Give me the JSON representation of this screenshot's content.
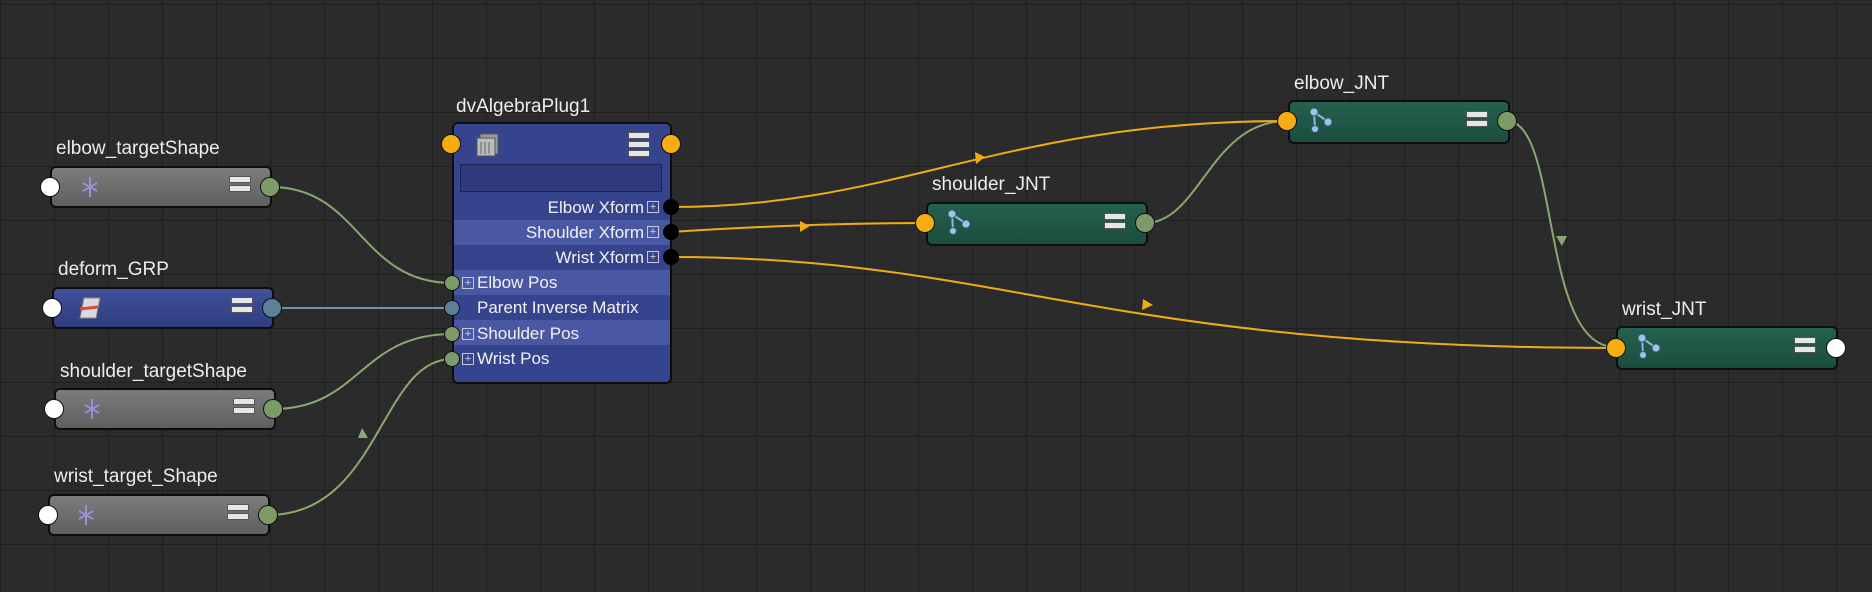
{
  "nodes": {
    "elbow_target": {
      "name": "elbow_targetShape",
      "icon": "locator-icon"
    },
    "deform_grp": {
      "name": "deform_GRP",
      "icon": "transform-icon"
    },
    "shoulder_target": {
      "name": "shoulder_targetShape",
      "icon": "locator-icon"
    },
    "wrist_target": {
      "name": "wrist_target_Shape",
      "icon": "locator-icon"
    },
    "plug": {
      "name": "dvAlgebraPlug1",
      "icon": "plugin-node-icon",
      "outputs": [
        "Elbow Xform",
        "Shoulder Xform",
        "Wrist Xform"
      ],
      "inputs": [
        "Elbow Pos",
        "Parent Inverse Matrix",
        "Shoulder Pos",
        "Wrist Pos"
      ]
    },
    "shoulder_jnt": {
      "name": "shoulder_JNT",
      "icon": "joint-icon"
    },
    "elbow_jnt": {
      "name": "elbow_JNT",
      "icon": "joint-icon"
    },
    "wrist_jnt": {
      "name": "wrist_JNT",
      "icon": "joint-icon"
    }
  },
  "colors": {
    "background": "#2b2b2b",
    "grid": "#1f1f1f",
    "matrix_wire": "#f0ac14",
    "vector_wire": "#8aa86e",
    "teal_wire": "#6f93a3",
    "joint_node": "#1d5343",
    "plug_node": "#36438d",
    "shape_node": "#6b6b6b"
  }
}
